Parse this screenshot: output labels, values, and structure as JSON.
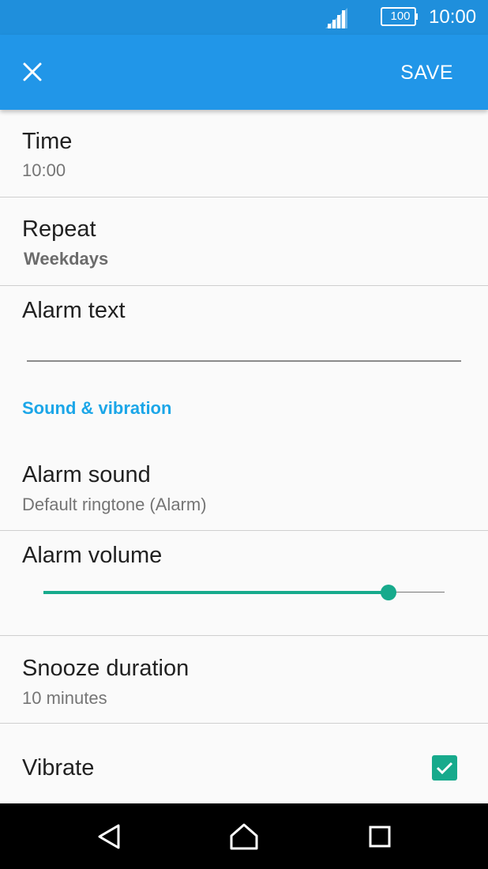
{
  "status_bar": {
    "battery": "100",
    "time": "10:00",
    "signal_icon": "signal-icon",
    "battery_icon": "battery-icon"
  },
  "app_bar": {
    "close_icon": "close-icon",
    "save_label": "SAVE"
  },
  "settings": {
    "time": {
      "title": "Time",
      "value": "10:00"
    },
    "repeat": {
      "title": "Repeat",
      "value": "Weekdays"
    },
    "alarm_text": {
      "title": "Alarm text",
      "value": ""
    },
    "section_header": "Sound & vibration",
    "alarm_sound": {
      "title": "Alarm sound",
      "value": "Default ringtone (Alarm)"
    },
    "alarm_volume": {
      "title": "Alarm volume",
      "level_fraction": 0.86
    },
    "snooze": {
      "title": "Snooze duration",
      "value": "10 minutes"
    },
    "vibrate": {
      "title": "Vibrate",
      "checked": true
    }
  },
  "nav_bar": {
    "back_icon": "back-icon",
    "home_icon": "home-icon",
    "recents_icon": "recents-icon"
  },
  "colors": {
    "app_bar": "#2196e8",
    "status_bar": "#1f8fdc",
    "accent": "#17aa8c",
    "section_header": "#1ba6e8"
  }
}
